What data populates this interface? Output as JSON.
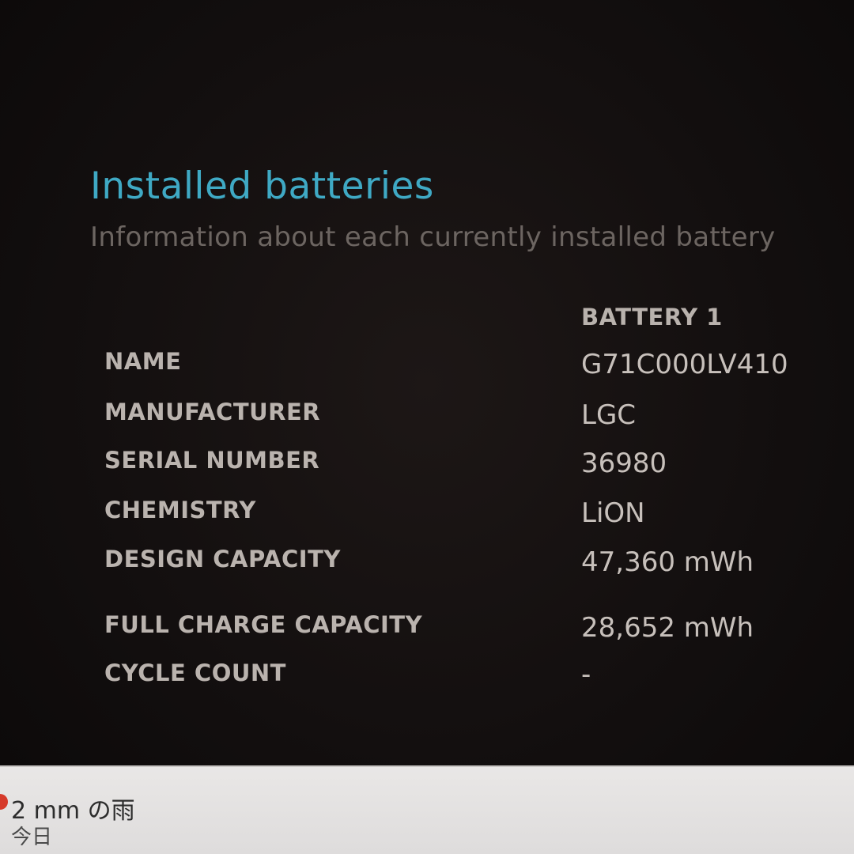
{
  "report": {
    "title": "Installed batteries",
    "subtitle": "Information about each currently installed battery",
    "column_header": "BATTERY 1",
    "rows": [
      {
        "label": "NAME",
        "value": "G71C000LV410"
      },
      {
        "label": "MANUFACTURER",
        "value": "LGC"
      },
      {
        "label": "SERIAL NUMBER",
        "value": "36980"
      },
      {
        "label": "CHEMISTRY",
        "value": "LiON"
      },
      {
        "label": "DESIGN CAPACITY",
        "value": "47,360 mWh"
      },
      {
        "label": "FULL CHARGE CAPACITY",
        "value": "28,652 mWh"
      },
      {
        "label": "CYCLE COUNT",
        "value": "-"
      }
    ]
  },
  "taskbar": {
    "weather": {
      "icon": "rain-weather-icon",
      "text": "2 mm の雨",
      "subtext": "今日"
    }
  }
}
